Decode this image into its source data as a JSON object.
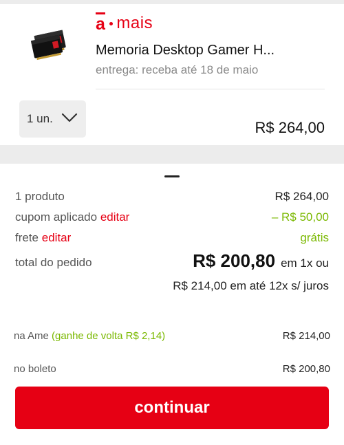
{
  "brand": {
    "logo_text_a": "a",
    "logo_text_mais": "mais",
    "accent_color": "#e60014"
  },
  "product": {
    "title": "Memoria Desktop Gamer H...",
    "delivery": "entrega: receba até 18 de maio",
    "quantity_label": "1 un.",
    "price": "R$ 264,00",
    "thumbnail_icon": "memory-module-icon"
  },
  "summary": {
    "products_label": "1 produto",
    "products_value": "R$ 264,00",
    "coupon_label": "cupom aplicado",
    "coupon_edit": "editar",
    "coupon_value": "– R$ 50,00",
    "shipping_label": "frete",
    "shipping_edit": "editar",
    "shipping_value": "grátis",
    "total_label": "total do pedido",
    "total_value": "R$ 200,80",
    "total_installment_note": "em 1x ou",
    "installments": "R$ 214,00 em até 12x s/ juros"
  },
  "payment_options": [
    {
      "label": "na Ame",
      "cashback": "(ganhe de volta R$ 2,14)",
      "value": "R$ 214,00"
    },
    {
      "label": "no boleto",
      "value": "R$ 200,80"
    }
  ],
  "actions": {
    "continue_label": "continuar"
  },
  "colors": {
    "accent": "#e60014",
    "green": "#7ab800"
  }
}
